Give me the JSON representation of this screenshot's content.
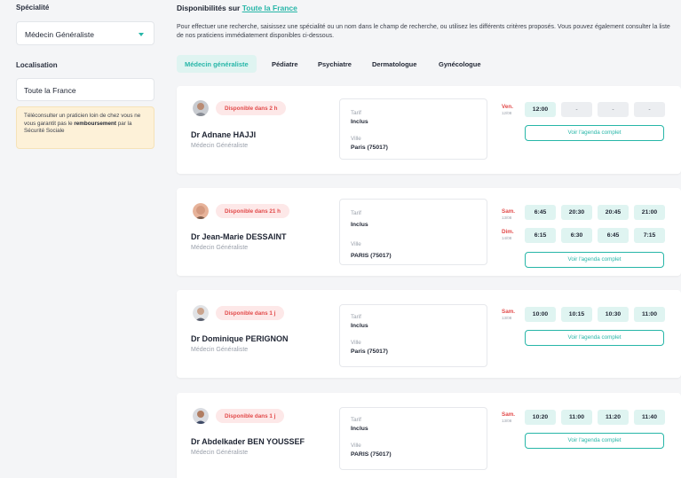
{
  "sidebar": {
    "specialite_label": "Spécialité",
    "specialite_value": "Médecin Généraliste",
    "localisation_label": "Localisation",
    "localisation_value": "Toute la France",
    "notice_text": "Téléconsulter un praticien loin de chez vous ne vous garantit pas le ",
    "notice_bold": "remboursement",
    "notice_after": " par la Sécurité Sociale"
  },
  "main": {
    "title_prefix": "Disponibilités sur ",
    "title_link": "Toute la France",
    "description": "Pour effectuer une recherche, saisissez une spécialité ou un nom dans le champ de recherche, ou utilisez les différents critères proposés. Vous pouvez également consulter la liste de nos praticiens immédiatement disponibles ci-dessous.",
    "tabs": [
      "Médecin généraliste",
      "Pédiatre",
      "Psychiatre",
      "Dermatologue",
      "Gynécologue"
    ]
  },
  "labels": {
    "tarif": "Tarif",
    "ville": "Ville",
    "agenda": "Voir l'agenda complet"
  },
  "doctors": [
    {
      "badge": "Disponible dans 2 h",
      "name": "Dr Adnane HAJJI",
      "specialty": "Médecin Généraliste",
      "tarif": "Inclus",
      "ville": "Paris (75017)",
      "days": [
        {
          "day": "Ven.",
          "date": "12/08",
          "slots": [
            "12:00",
            "-",
            "-",
            "-"
          ]
        }
      ]
    },
    {
      "badge": "Disponible dans 21 h",
      "name": "Dr Jean-Marie DESSAINT",
      "specialty": "Médecin Généraliste",
      "tarif": "Inclus",
      "ville": "PARIS (75017)",
      "days": [
        {
          "day": "Sam.",
          "date": "13/08",
          "slots": [
            "6:45",
            "20:30",
            "20:45",
            "21:00"
          ]
        },
        {
          "day": "Dim.",
          "date": "14/08",
          "slots": [
            "6:15",
            "6:30",
            "6:45",
            "7:15"
          ]
        }
      ]
    },
    {
      "badge": "Disponible dans 1 j",
      "name": "Dr Dominique PERIGNON",
      "specialty": "Médecin Généraliste",
      "tarif": "Inclus",
      "ville": "Paris (75017)",
      "days": [
        {
          "day": "Sam.",
          "date": "13/08",
          "slots": [
            "10:00",
            "10:15",
            "10:30",
            "11:00"
          ]
        }
      ]
    },
    {
      "badge": "Disponible dans 1 j",
      "name": "Dr Abdelkader BEN YOUSSEF",
      "specialty": "Médecin Généraliste",
      "tarif": "Inclus",
      "ville": "PARIS (75017)",
      "days": [
        {
          "day": "Sam.",
          "date": "13/08",
          "slots": [
            "10:20",
            "11:00",
            "11:20",
            "11:40"
          ]
        }
      ]
    }
  ],
  "colors": {
    "accent": "#27b6a8",
    "badge_text": "#e24a4a",
    "badge_bg": "#fde8e8",
    "slot_bg": "#dff4f1",
    "notice_bg": "#fdf1d8"
  }
}
